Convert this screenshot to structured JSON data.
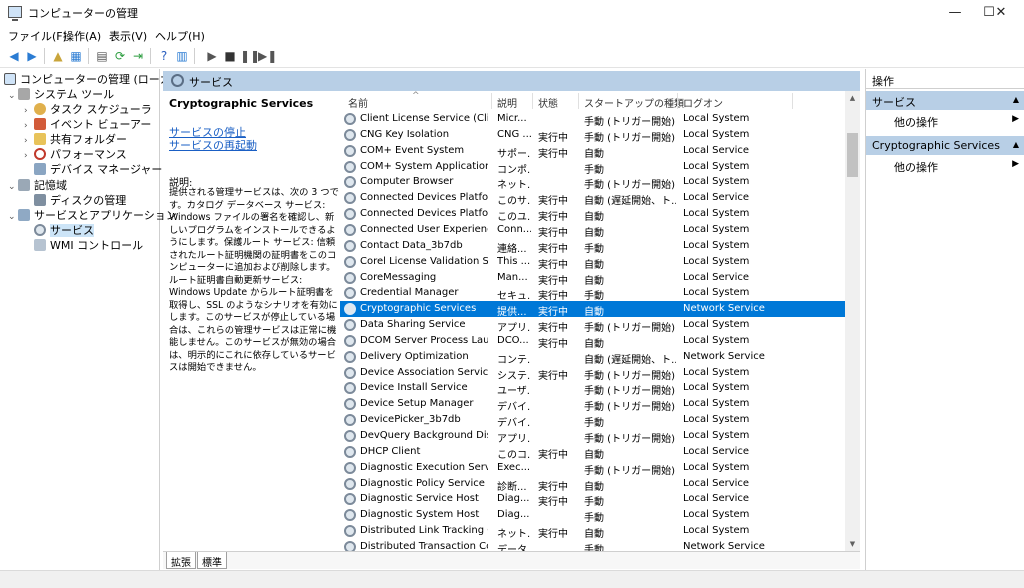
{
  "window": {
    "title": "コンピューターの管理",
    "minimize": "—",
    "maximize": "☐",
    "close": "✕"
  },
  "menu": [
    "ファイル(F)",
    "操作(A)",
    "表示(V)",
    "ヘルプ(H)"
  ],
  "tree": {
    "root": "コンピューターの管理 (ローカル)",
    "system_tools": "システム ツール",
    "task_scheduler": "タスク スケジューラ",
    "event_viewer": "イベント ビューアー",
    "shared_folders": "共有フォルダー",
    "performance": "パフォーマンス",
    "device_manager": "デバイス マネージャー",
    "storage": "記憶域",
    "disk_management": "ディスクの管理",
    "services_apps": "サービスとアプリケーション",
    "services": "サービス",
    "wmi": "WMI コントロール"
  },
  "main": {
    "header": "サービス",
    "selected_service": "Cryptographic Services",
    "link_stop": "サービスの停止",
    "link_restart": "サービスの再起動",
    "desc_label": "説明:",
    "description": "提供される管理サービスは、次の 3 つです。カタログ データベース サービス: Windows ファイルの署名を確認し、新しいプログラムをインストールできるようにします。保護ルート サービス: 信頼されたルート証明機関の証明書をこのコンピューターに追加および削除します。ルート証明書自動更新サービス: Windows Update からルート証明書を取得し、SSL のようなシナリオを有効にします。このサービスが停止している場合は、これらの管理サービスは正常に機能しません。このサービスが無効の場合は、明示的にこれに依存しているサービスは開始できません。",
    "columns": [
      "名前",
      "説明",
      "状態",
      "スタートアップの種類",
      "ログオン"
    ],
    "rows": [
      [
        "Client License Service (ClipS",
        "Micr...",
        "",
        "手動 (トリガー開始)",
        "Local System"
      ],
      [
        "CNG Key Isolation",
        "CNG ...",
        "実行中",
        "手動 (トリガー開始)",
        "Local System"
      ],
      [
        "COM+ Event System",
        "サポー...",
        "実行中",
        "自動",
        "Local Service"
      ],
      [
        "COM+ System Application",
        "コンポ...",
        "",
        "手動",
        "Local System"
      ],
      [
        "Computer Browser",
        "ネット...",
        "",
        "手動 (トリガー開始)",
        "Local System"
      ],
      [
        "Connected Devices Platfor...",
        "このサ...",
        "実行中",
        "自動 (遅延開始、ト...",
        "Local Service"
      ],
      [
        "Connected Devices Platfor...",
        "このユ...",
        "実行中",
        "自動",
        "Local System"
      ],
      [
        "Connected User Experience...",
        "Conn...",
        "実行中",
        "自動",
        "Local System"
      ],
      [
        "Contact Data_3b7db",
        "連絡...",
        "実行中",
        "手動",
        "Local System"
      ],
      [
        "Corel License Validation Ser...",
        "This ...",
        "実行中",
        "自動",
        "Local System"
      ],
      [
        "CoreMessaging",
        "Man...",
        "実行中",
        "自動",
        "Local Service"
      ],
      [
        "Credential Manager",
        "セキュ...",
        "実行中",
        "手動",
        "Local System"
      ],
      [
        "Cryptographic Services",
        "提供...",
        "実行中",
        "自動",
        "Network Service"
      ],
      [
        "Data Sharing Service",
        "アプリ...",
        "実行中",
        "手動 (トリガー開始)",
        "Local System"
      ],
      [
        "DCOM Server Process Laun...",
        "DCO...",
        "実行中",
        "自動",
        "Local System"
      ],
      [
        "Delivery Optimization",
        "コンテ...",
        "",
        "自動 (遅延開始、ト...",
        "Network Service"
      ],
      [
        "Device Association Service",
        "システ...",
        "実行中",
        "手動 (トリガー開始)",
        "Local System"
      ],
      [
        "Device Install Service",
        "ユーザ...",
        "",
        "手動 (トリガー開始)",
        "Local System"
      ],
      [
        "Device Setup Manager",
        "デバイ...",
        "",
        "手動 (トリガー開始)",
        "Local System"
      ],
      [
        "DevicePicker_3b7db",
        "デバイ...",
        "",
        "手動",
        "Local System"
      ],
      [
        "DevQuery Background Disc...",
        "アプリ...",
        "",
        "手動 (トリガー開始)",
        "Local System"
      ],
      [
        "DHCP Client",
        "このコ...",
        "実行中",
        "自動",
        "Local Service"
      ],
      [
        "Diagnostic Execution Service",
        "Exec...",
        "",
        "手動 (トリガー開始)",
        "Local System"
      ],
      [
        "Diagnostic Policy Service",
        "診断...",
        "実行中",
        "自動",
        "Local Service"
      ],
      [
        "Diagnostic Service Host",
        "Diag...",
        "実行中",
        "手動",
        "Local Service"
      ],
      [
        "Diagnostic System Host",
        "Diag...",
        "",
        "手動",
        "Local System"
      ],
      [
        "Distributed Link Tracking Cli",
        "ネット...",
        "実行中",
        "自動",
        "Local System"
      ],
      [
        "Distributed Transaction Coo...",
        "データ...",
        "",
        "手動",
        "Network Service"
      ]
    ],
    "tabs": [
      "拡張",
      "標準"
    ]
  },
  "actions": {
    "title": "操作",
    "section1": "サービス",
    "section2": "Cryptographic Services",
    "more": "他の操作"
  },
  "colors": {
    "selection": "#0078d7",
    "pane_header": "#b8cfe6"
  }
}
